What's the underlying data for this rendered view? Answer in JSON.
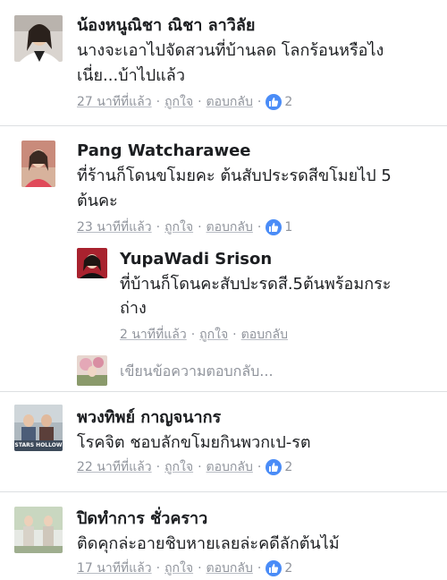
{
  "comments": [
    {
      "author": "น้องหนูณิชา ณิชา ลาวิลัย",
      "text_lines": [
        "นางจะเอาไปจัดสวนที่บ้านลด โลกร้อนหรือไง",
        "เนี่ย...บ้าไปแล้ว"
      ],
      "time": "27 นาทีที่แล้ว",
      "like_label": "ถูกใจ",
      "reply_label": "ตอบกลับ",
      "reactions": "2"
    },
    {
      "author": "Pang Watcharawee",
      "text_lines": [
        "ที่ร้านก็โดนขโมยคะ  ต้นสับประรดสีขโมยไป 5",
        "ต้นคะ"
      ],
      "time": "23 นาทีที่แล้ว",
      "like_label": "ถูกใจ",
      "reply_label": "ตอบกลับ",
      "reactions": "1"
    },
    {
      "author": "พวงทิพย์ กาญจนากร",
      "text_lines": [
        "โรคจิต ชอบลักขโมยกินพวกเป-รต"
      ],
      "time": "22 นาทีที่แล้ว",
      "like_label": "ถูกใจ",
      "reply_label": "ตอบกลับ",
      "reactions": "2",
      "avatar_caption": "STARS HOLLOW"
    },
    {
      "author": "ปิดทำการ ชั่วคราว",
      "text_lines": [
        "ติดคุกล่ะอายชิบหายเลยล่ะคดีลักต้นไม้"
      ],
      "time": "17 นาทีที่แล้ว",
      "like_label": "ถูกใจ",
      "reply_label": "ตอบกลับ",
      "reactions": "2"
    }
  ],
  "reply": {
    "author": "YupaWadi Srison",
    "text_lines": [
      "ที่บ้านก็โดนคะสับปะรดสี.5ต้นพร้อมกระ",
      "ถ่าง"
    ],
    "time": "2 นาทีที่แล้ว",
    "like_label": "ถูกใจ",
    "reply_label": "ตอบกลับ"
  },
  "reply_box": {
    "placeholder": "เขียนข้อความตอบกลับ..."
  },
  "separator": "·",
  "colors": {
    "like_badge": "#4a8cf7",
    "meta_text": "#90949c",
    "divider": "#dddfe2"
  }
}
